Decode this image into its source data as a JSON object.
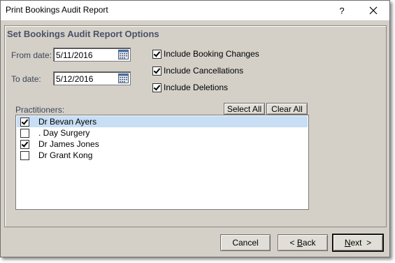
{
  "window": {
    "title": "Print Bookings Audit Report",
    "help_label": "?",
    "close_label": "✕"
  },
  "panel": {
    "heading": "Set Bookings Audit Report Options"
  },
  "dates": {
    "from_label": "From date:",
    "from_value": "5/11/2016",
    "to_label": "To date:",
    "to_value": "5/12/2016"
  },
  "options": [
    {
      "label": "Include Booking Changes",
      "checked": true
    },
    {
      "label": "Include Cancellations",
      "checked": true
    },
    {
      "label": "Include Deletions",
      "checked": true
    }
  ],
  "practitioners": {
    "label": "Practitioners:",
    "select_all_label": "Select All",
    "clear_all_label": "Clear All",
    "items": [
      {
        "name": "Dr Bevan Ayers",
        "checked": true,
        "selected": true
      },
      {
        "name": ". Day Surgery",
        "checked": false,
        "selected": false
      },
      {
        "name": "Dr James Jones",
        "checked": true,
        "selected": false
      },
      {
        "name": "Dr Grant Kong",
        "checked": false,
        "selected": false
      }
    ]
  },
  "footer": {
    "cancel_label": "Cancel",
    "back_prefix": "< ",
    "back_mnemonic": "B",
    "back_rest": "ack",
    "next_mnemonic": "N",
    "next_rest": "ext  >"
  }
}
